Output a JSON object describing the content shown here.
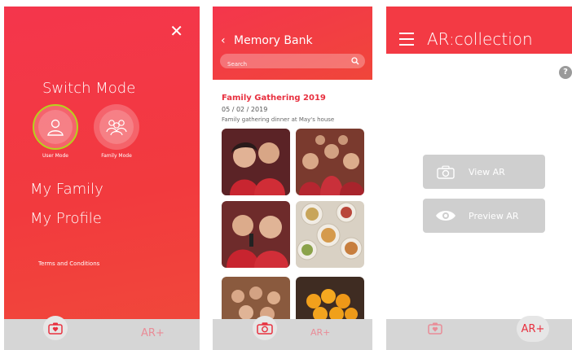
{
  "screen1": {
    "switch_title": "Switch Mode",
    "user_mode_label": "User Mode",
    "family_mode_label": "Family Mode",
    "my_family": "My Family",
    "my_profile": "My Profile",
    "terms": "Terms and Conditions",
    "ar_plus": "AR+",
    "colors": {
      "accent": "#f23a3e",
      "active_ring": "#b7d21c"
    }
  },
  "screen2": {
    "back_glyph": "‹",
    "title": "Memory Bank",
    "search_placeholder": "Search",
    "album": {
      "title": "Family Gathering 2019",
      "date": "05 / 02 / 2019",
      "description": "Family gathering dinner at May's house"
    },
    "ar_plus": "AR+"
  },
  "screen3": {
    "title": "AR:collection",
    "help": "?",
    "view_ar": "View AR",
    "preview_ar": "Preview AR",
    "ar_plus": "AR+"
  }
}
